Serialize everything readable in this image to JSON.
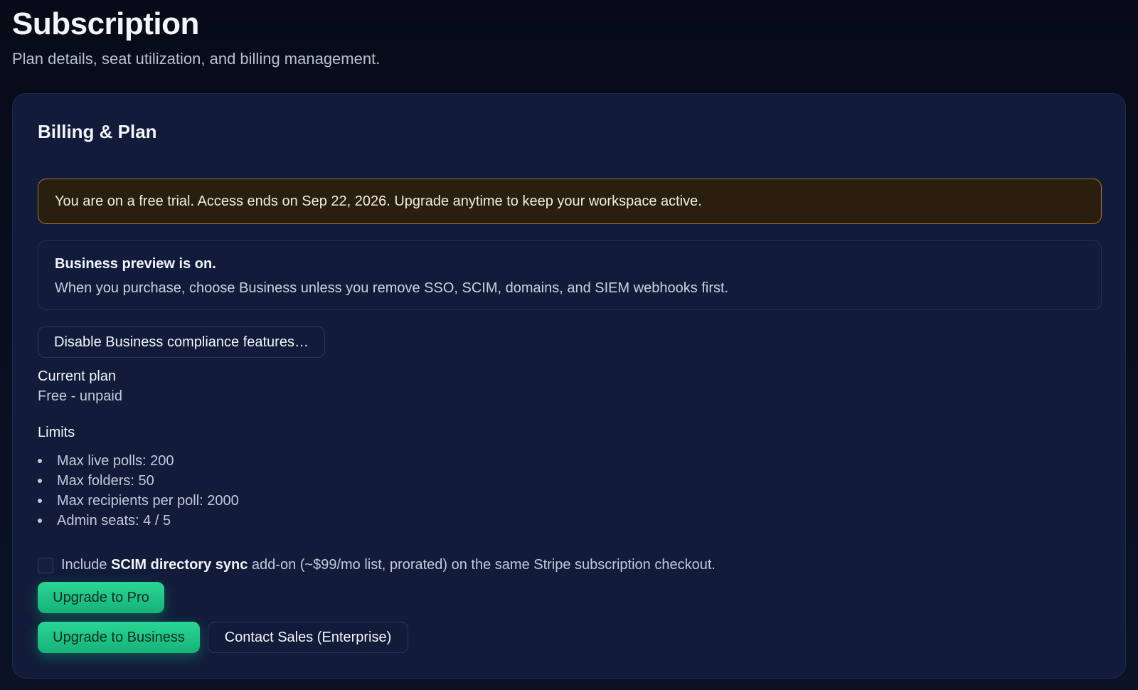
{
  "header": {
    "title": "Subscription",
    "subtitle": "Plan details, seat utilization, and billing management."
  },
  "card": {
    "title": "Billing & Plan",
    "trial_banner": "You are on a free trial. Access ends on Sep 22, 2026. Upgrade anytime to keep your workspace active.",
    "preview": {
      "title": "Business preview is on.",
      "text": "When you purchase, choose Business unless you remove SSO, SCIM, domains, and SIEM webhooks first."
    },
    "disable_button": "Disable Business compliance features…",
    "current_plan": {
      "label": "Current plan",
      "value": "Free - unpaid"
    },
    "limits": {
      "label": "Limits",
      "items": [
        "Max live polls: 200",
        "Max folders: 50",
        "Max recipients per poll: 2000",
        "Admin seats: 4 / 5"
      ]
    },
    "addon": {
      "checked": false,
      "prefix": "Include ",
      "name": "SCIM directory sync",
      "suffix": " add-on (~$99/mo list, prorated) on the same Stripe subscription checkout."
    },
    "buttons": {
      "upgrade_pro": "Upgrade to Pro",
      "upgrade_business": "Upgrade to Business",
      "contact_sales": "Contact Sales (Enterprise)"
    }
  },
  "colors": {
    "background": "#070b18",
    "card": "#121c3a",
    "trial_banner_bg": "#2a1e0f",
    "trial_banner_border": "#a2702c",
    "accent_green": "#1fc486"
  }
}
